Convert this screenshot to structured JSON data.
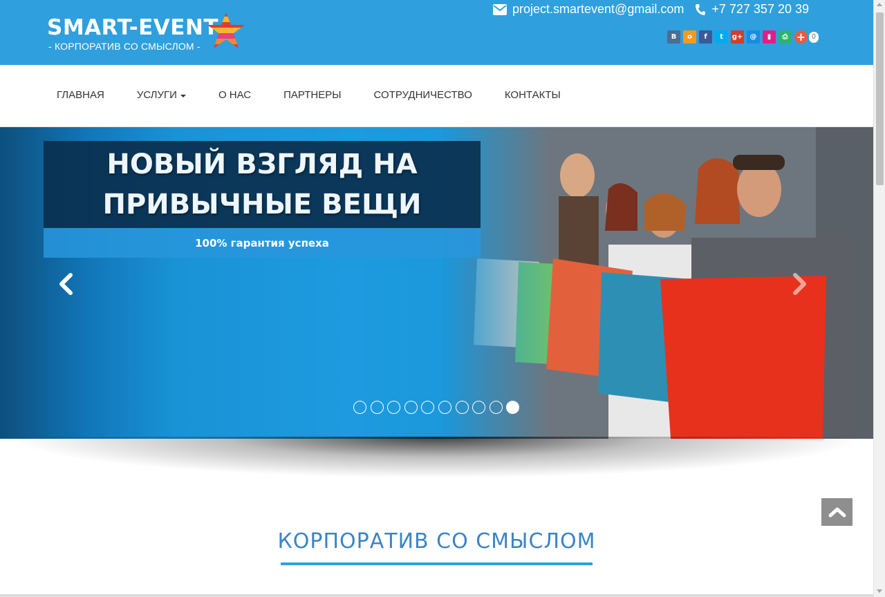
{
  "header": {
    "logo_title": "SMART-EVENT",
    "logo_subtitle": "- КОРПОРАТИВ СО СМЫСЛОМ -",
    "email": "project.smartevent@gmail.com",
    "phone": "+7 727 357 20 39",
    "email_icon": "envelope-icon",
    "phone_icon": "phone-icon",
    "background_color": "#2f9fde"
  },
  "share": {
    "buttons": [
      {
        "name": "vkontakte",
        "glyph": "В",
        "color": "#4c6c91"
      },
      {
        "name": "odnoklassniki",
        "glyph": "о",
        "color": "#f59a1b"
      },
      {
        "name": "facebook",
        "glyph": "f",
        "color": "#3b5998"
      },
      {
        "name": "twitter",
        "glyph": "t",
        "color": "#00aced"
      },
      {
        "name": "google-plus",
        "glyph": "g+",
        "color": "#d23e2b"
      },
      {
        "name": "mail-ru",
        "glyph": "@",
        "color": "#168de2"
      },
      {
        "name": "bookmark",
        "glyph": "▮",
        "color": "#e31e85"
      },
      {
        "name": "print",
        "glyph": "⎙",
        "color": "#2db46c"
      },
      {
        "name": "more",
        "glyph": "+",
        "color": "#e85d3a"
      }
    ],
    "count": "0"
  },
  "nav": {
    "items": [
      {
        "label": "ГЛАВНАЯ"
      },
      {
        "label": "УСЛУГИ",
        "dropdown": true
      },
      {
        "label": "О НАС"
      },
      {
        "label": "ПАРТНЕРЫ"
      },
      {
        "label": "СОТРУДНИЧЕСТВО"
      },
      {
        "label": "КОНТАКТЫ"
      }
    ]
  },
  "slider": {
    "title_line1": "НОВЫЙ ВЗГЛЯД НА",
    "title_line2": "ПРИВЫЧНЫЕ ВЕЩИ",
    "subtitle": "100% гарантия успеха",
    "slide_count": 10,
    "active_index": 9,
    "prev_icon": "chevron-left-icon",
    "next_icon": "chevron-right-icon"
  },
  "section": {
    "title": "КОРПОРАТИВ СО СМЫСЛОМ",
    "accent_color": "#3a84c6"
  },
  "to_top_icon": "chevron-up-icon"
}
